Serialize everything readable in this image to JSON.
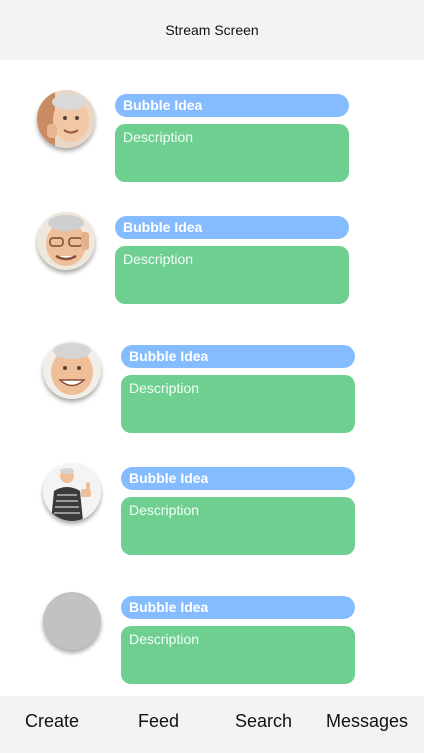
{
  "header": {
    "title": "Stream Screen"
  },
  "posts": [
    {
      "title": "Bubble Idea",
      "description": "Description",
      "avatar_icon": "man-face-photo-icon"
    },
    {
      "title": "Bubble Idea",
      "description": "Description",
      "avatar_icon": "man-glasses-photo-icon"
    },
    {
      "title": "Bubble Idea",
      "description": "Description",
      "avatar_icon": "smiling-man-photo-icon"
    },
    {
      "title": "Bubble Idea",
      "description": "Description",
      "avatar_icon": "man-thumbs-up-photo-icon"
    },
    {
      "title": "Bubble Idea",
      "description": "Description",
      "avatar_icon": "placeholder-avatar-icon"
    }
  ],
  "nav": {
    "items": [
      "Create",
      "Feed",
      "Search",
      "Messages"
    ]
  },
  "colors": {
    "header_bg": "#f3f3f3",
    "title_bubble": "#85bbff",
    "description_bubble": "#6ecf91",
    "placeholder_avatar": "#c2c2c2"
  }
}
